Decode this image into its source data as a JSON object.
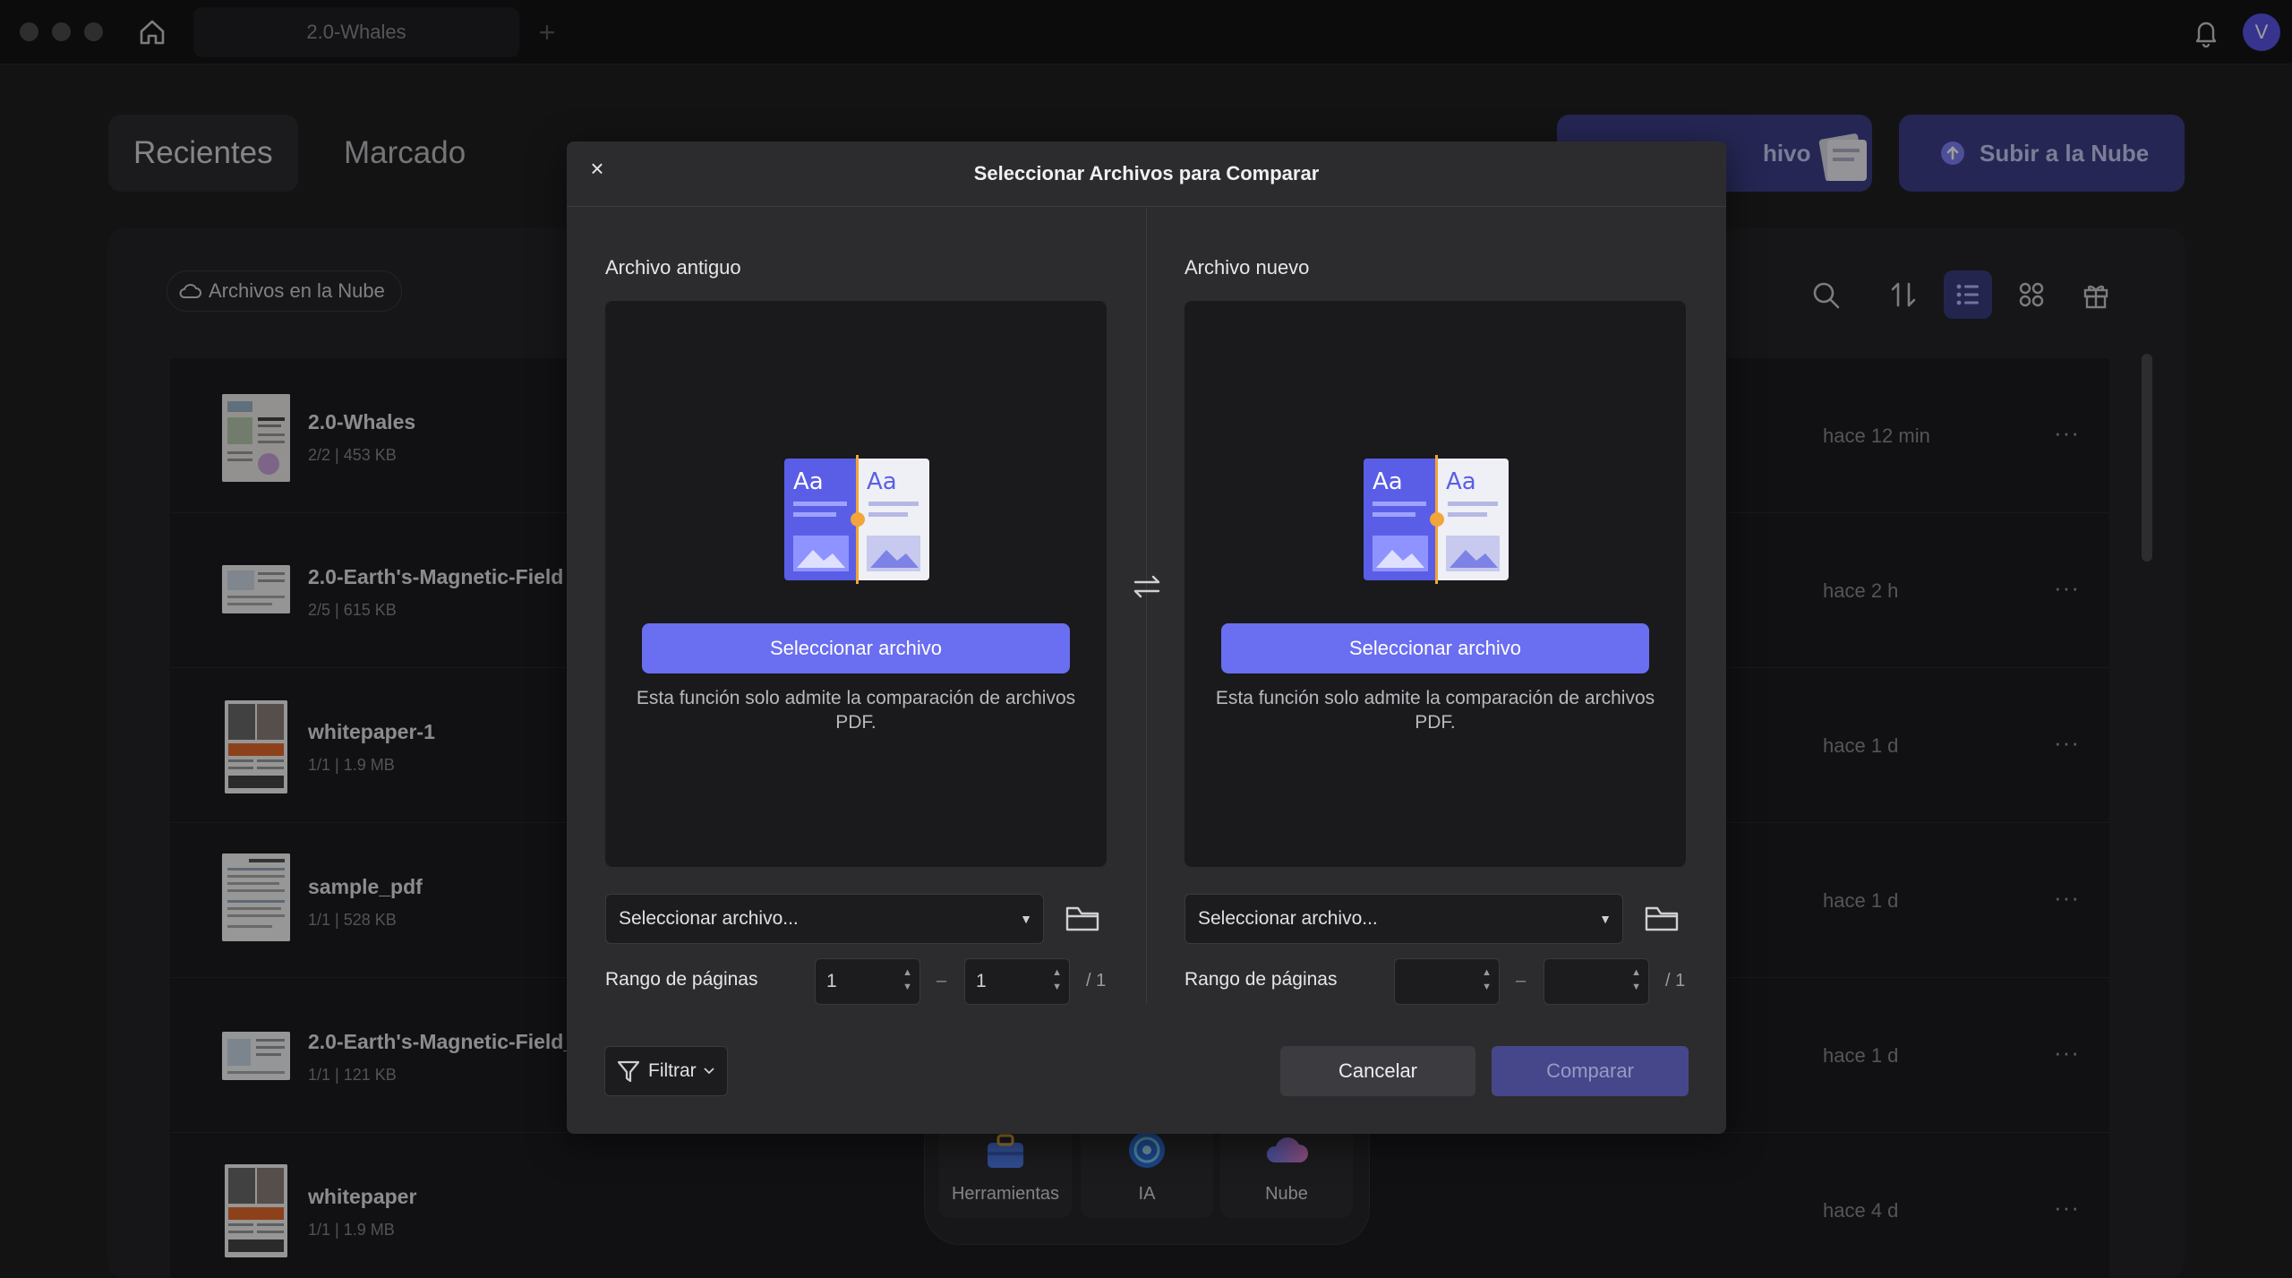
{
  "titlebar": {
    "tab_title": "2.0-Whales",
    "new_tab": "+",
    "avatar_initial": "V"
  },
  "nav": {
    "recientes": "Recientes",
    "marcado": "Marcado",
    "open_file_partial": "hivo",
    "upload": "Subir a la Nube"
  },
  "cloud_chip": "Archivos en la Nube",
  "files": [
    {
      "name": "2.0-Whales",
      "meta": "2/2 | 453 KB",
      "time": "hace 12 min",
      "more": "···"
    },
    {
      "name": "2.0-Earth's-Magnetic-Field",
      "meta": "2/5 | 615 KB",
      "time": "hace 2 h",
      "more": "···"
    },
    {
      "name": "whitepaper-1",
      "meta": "1/1 | 1.9 MB",
      "time": "hace 1 d",
      "more": "···"
    },
    {
      "name": "sample_pdf",
      "meta": "1/1 | 528 KB",
      "time": "hace 1 d",
      "more": "···"
    },
    {
      "name": "2.0-Earth's-Magnetic-Field_",
      "meta": "1/1 | 121 KB",
      "time": "hace 1 d",
      "more": "···"
    },
    {
      "name": "whitepaper",
      "meta": "1/1 | 1.9 MB",
      "time": "hace 4 d",
      "more": "···"
    }
  ],
  "dock": {
    "tools": "Herramientas",
    "ai": "IA",
    "cloud": "Nube"
  },
  "modal": {
    "title": "Seleccionar Archivos para Comparar",
    "close": "×",
    "old": {
      "heading": "Archivo antiguo",
      "button": "Seleccionar archivo",
      "note": "Esta función solo admite la comparación de archivos PDF.",
      "dropdown": "Seleccionar archivo...",
      "range_label": "Rango de páginas",
      "from": "1",
      "to": "1",
      "total": "/ 1"
    },
    "new": {
      "heading": "Archivo nuevo",
      "button": "Seleccionar archivo",
      "note": "Esta función solo admite la comparación de archivos PDF.",
      "dropdown": "Seleccionar archivo...",
      "range_label": "Rango de páginas",
      "from": "",
      "to": "",
      "total": "/ 1"
    },
    "dash": "–",
    "filter": "Filtrar",
    "cancel": "Cancelar",
    "compare": "Comparar"
  },
  "colors": {
    "accent": "#6a6ef0",
    "accent_dim": "#46478a",
    "panel": "#2c2c2f"
  },
  "icons": [
    "home-icon",
    "bell-icon",
    "cloud-icon",
    "search-icon",
    "sort-icon",
    "list-view-icon",
    "grid-view-icon",
    "gift-icon",
    "swap-icon",
    "folder-icon",
    "filter-icon",
    "upload-icon",
    "close-icon"
  ]
}
